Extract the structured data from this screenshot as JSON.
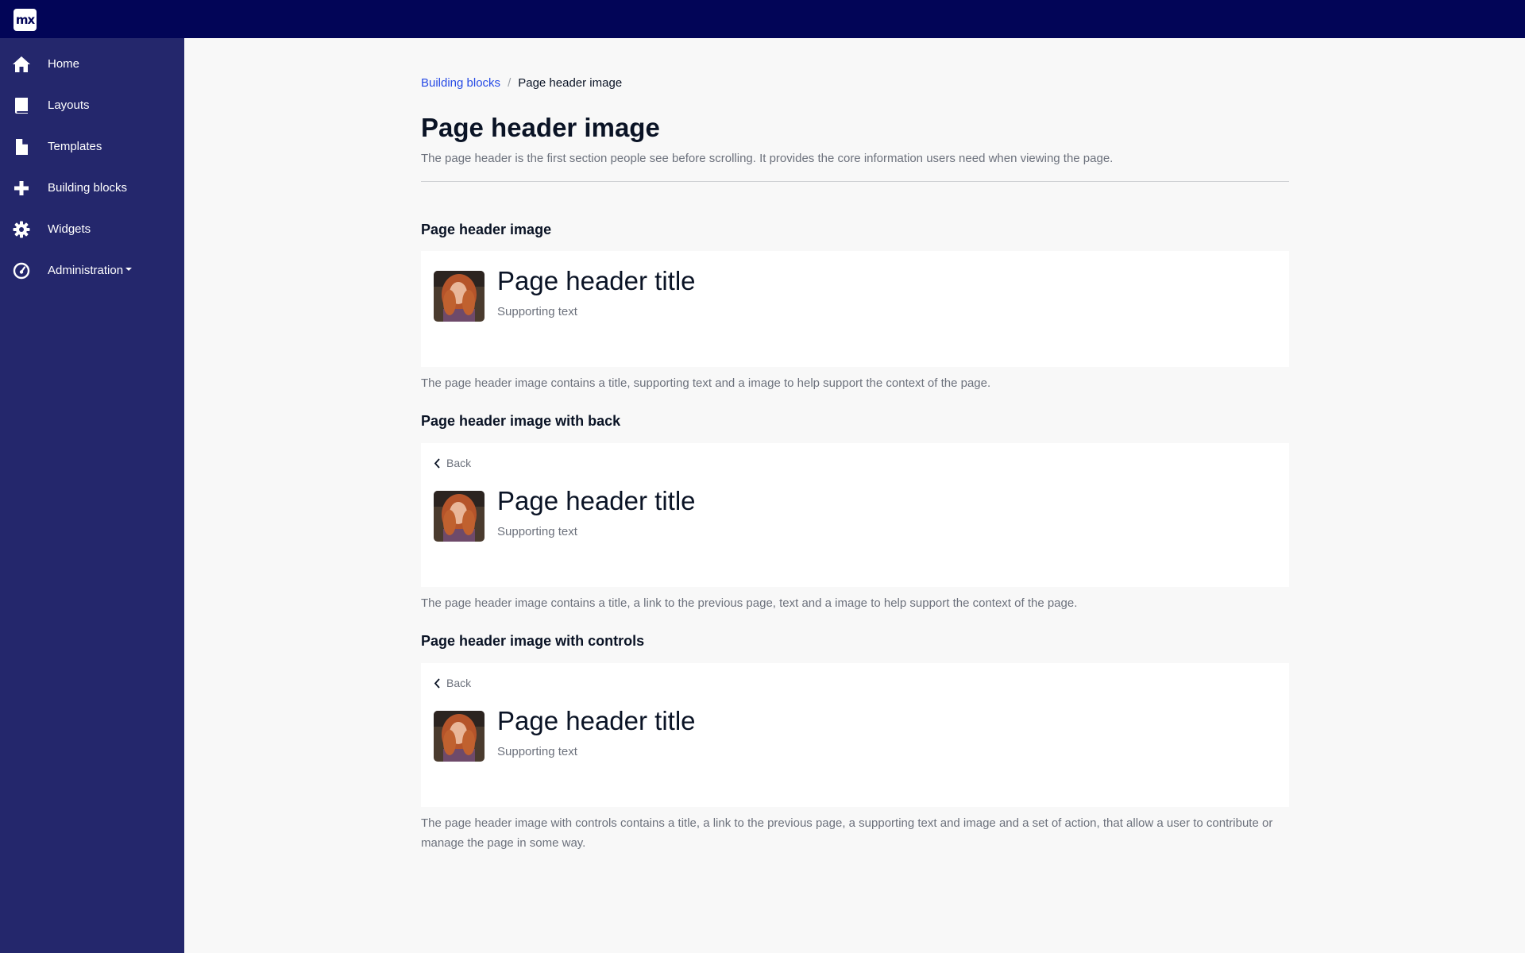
{
  "app": {
    "logo_text": "mx"
  },
  "sidebar": {
    "items": [
      {
        "label": "Home",
        "icon": "home-icon"
      },
      {
        "label": "Layouts",
        "icon": "book-icon"
      },
      {
        "label": "Templates",
        "icon": "file-icon"
      },
      {
        "label": "Building blocks",
        "icon": "plus-icon"
      },
      {
        "label": "Widgets",
        "icon": "gear-icon"
      },
      {
        "label": "Administration",
        "icon": "dashboard-icon"
      }
    ]
  },
  "breadcrumb": {
    "parent": "Building blocks",
    "separator": "/",
    "current": "Page header image"
  },
  "page": {
    "title": "Page header image",
    "description": "The page header is the first section people see before scrolling. It provides the core information users need when viewing the page."
  },
  "sections": [
    {
      "title": "Page header image",
      "card_title": "Page header title",
      "card_subtitle": "Supporting text",
      "caption": "The page header image contains a title, supporting text and a image to help support the context of the page."
    },
    {
      "title": "Page header image with back",
      "back_label": "Back",
      "card_title": "Page header title",
      "card_subtitle": "Supporting text",
      "caption": "The page header image contains a title, a link to the previous page, text and a image to help support the context of the page."
    },
    {
      "title": "Page header image with controls",
      "back_label": "Back",
      "card_title": "Page header title",
      "card_subtitle": "Supporting text",
      "caption": "The page header image with controls contains a title, a link to the previous page, a supporting text and image and a set of action, that allow a user to contribute or manage the page in some way."
    }
  ],
  "colors": {
    "topbar": "#020557",
    "sidebar": "#24276c",
    "link": "#264ae5",
    "background": "#f8f8f8"
  }
}
